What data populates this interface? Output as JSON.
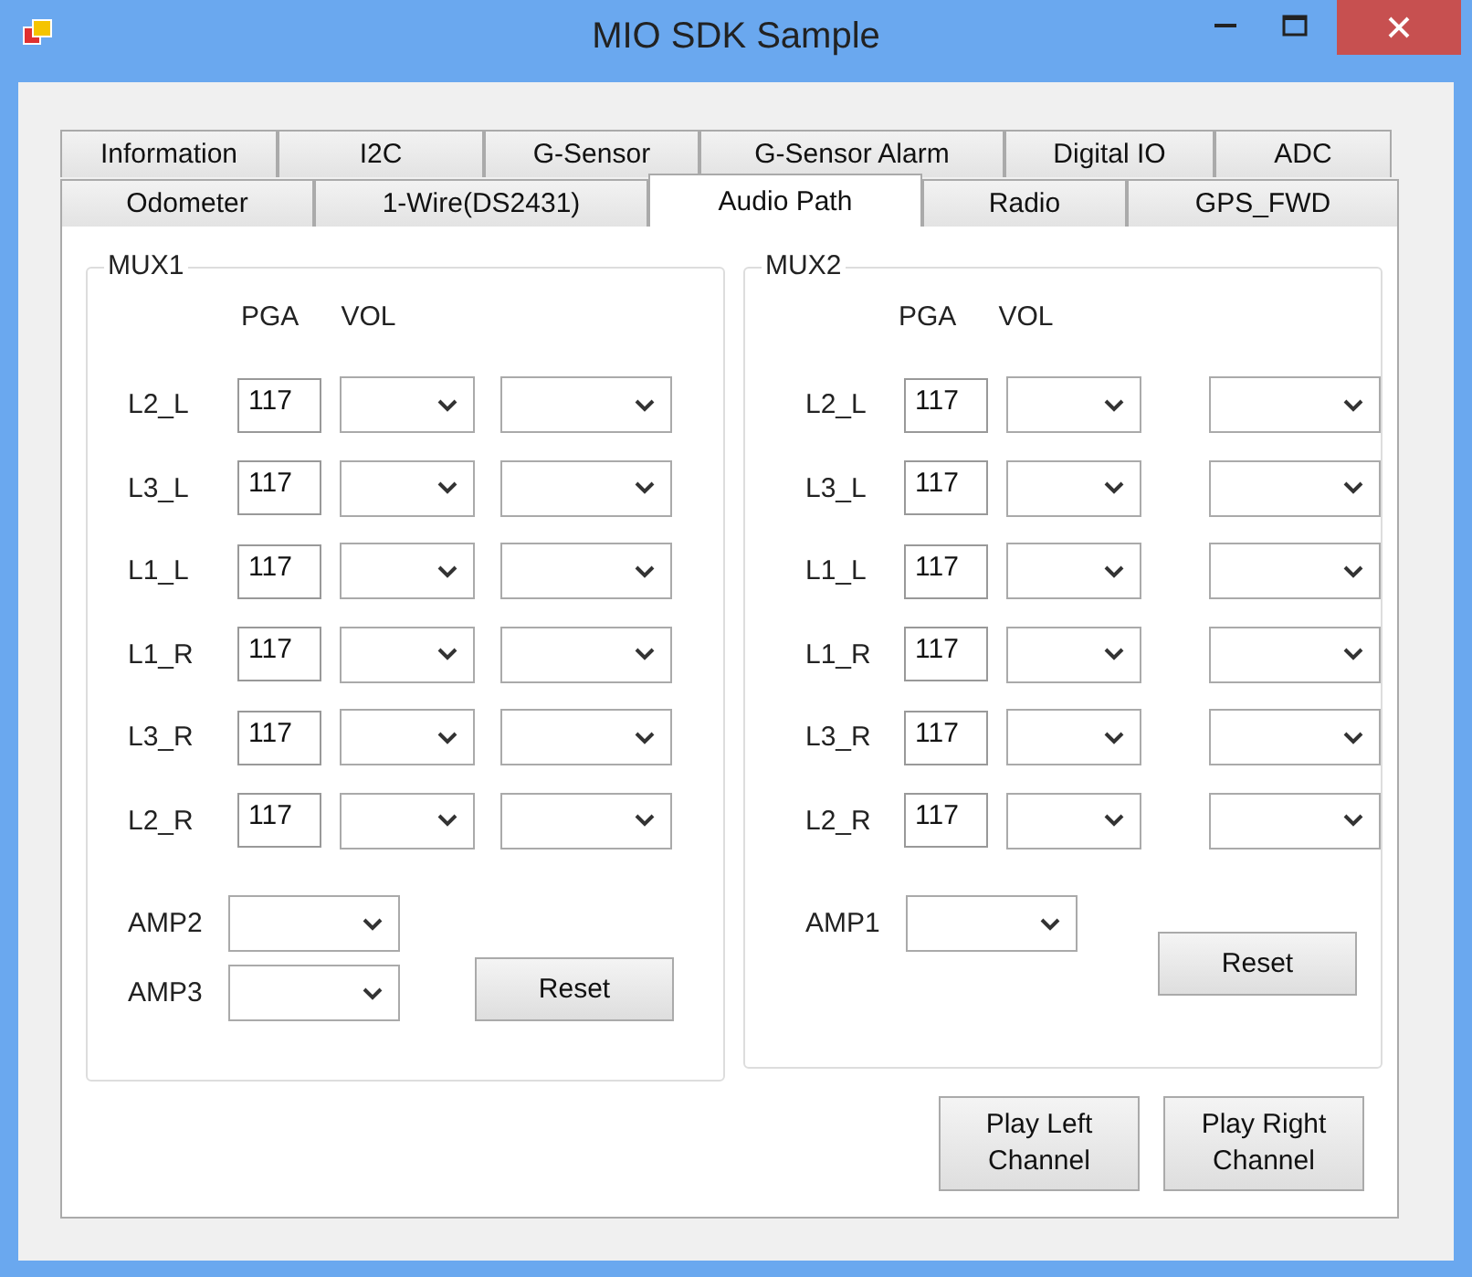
{
  "window": {
    "title": "MIO SDK Sample"
  },
  "tab_rows": [
    {
      "tabs": [
        {
          "label": "Information",
          "selected": false
        },
        {
          "label": "I2C",
          "selected": false
        },
        {
          "label": "G-Sensor",
          "selected": false
        },
        {
          "label": "G-Sensor Alarm",
          "selected": false
        },
        {
          "label": "Digital IO",
          "selected": false
        },
        {
          "label": "ADC",
          "selected": false
        }
      ]
    },
    {
      "tabs": [
        {
          "label": "Odometer",
          "selected": false
        },
        {
          "label": "1-Wire(DS2431)",
          "selected": false
        },
        {
          "label": "Audio Path",
          "selected": true
        },
        {
          "label": "Radio",
          "selected": false
        },
        {
          "label": "GPS_FWD",
          "selected": false
        }
      ]
    }
  ],
  "groups": [
    {
      "title": "MUX1",
      "headers": [
        "PGA",
        "VOL"
      ],
      "rows": [
        {
          "label": "L2_L",
          "pga": "117"
        },
        {
          "label": "L3_L",
          "pga": "117"
        },
        {
          "label": "L1_L",
          "pga": "117"
        },
        {
          "label": "L1_R",
          "pga": "117"
        },
        {
          "label": "L3_R",
          "pga": "117"
        },
        {
          "label": "L2_R",
          "pga": "117"
        }
      ],
      "amps": [
        {
          "label": "AMP2"
        },
        {
          "label": "AMP3"
        }
      ],
      "reset": "Reset"
    },
    {
      "title": "MUX2",
      "headers": [
        "PGA",
        "VOL"
      ],
      "rows": [
        {
          "label": "L2_L",
          "pga": "117"
        },
        {
          "label": "L3_L",
          "pga": "117"
        },
        {
          "label": "L1_L",
          "pga": "117"
        },
        {
          "label": "L1_R",
          "pga": "117"
        },
        {
          "label": "L3_R",
          "pga": "117"
        },
        {
          "label": "L2_R",
          "pga": "117"
        }
      ],
      "amps": [
        {
          "label": "AMP1"
        }
      ],
      "reset": "Reset"
    }
  ],
  "buttons": [
    "Play Left Channel",
    "Play Right Channel"
  ]
}
